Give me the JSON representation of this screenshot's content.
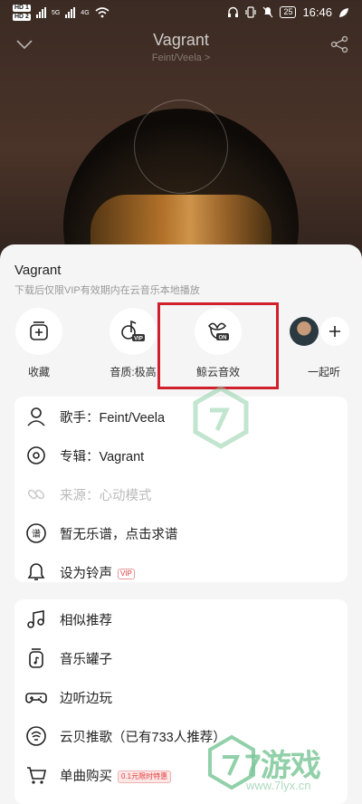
{
  "status_bar": {
    "hd1": "HD 1",
    "hd2": "HD 2",
    "net1": "5G",
    "net2": "4G",
    "battery": "25",
    "time": "16:46"
  },
  "player": {
    "title": "Vagrant",
    "artist": "Feint/Veela >"
  },
  "sheet": {
    "song_title": "Vagrant",
    "subtitle": "下载后仅限VIP有效期内在云音乐本地播放",
    "actions": [
      {
        "label": "收藏",
        "icon": "add-to-playlist-icon"
      },
      {
        "label": "音质:极高",
        "icon": "music-vip-icon"
      },
      {
        "label": "鲸云音效",
        "icon": "whale-sound-effect-on-icon"
      },
      {
        "label": "一起听",
        "icon": "listen-together-icon"
      }
    ],
    "info_rows": [
      {
        "label": "歌手：Feint/Veela",
        "icon": "person-icon"
      },
      {
        "label": "专辑：Vagrant",
        "icon": "disc-icon"
      },
      {
        "label": "来源：心动模式",
        "icon": "link-icon",
        "disabled": true
      },
      {
        "label": "暂无乐谱，点击求谱",
        "icon": "score-icon"
      },
      {
        "label": "设为铃声",
        "icon": "bell-icon",
        "badge": "VIP"
      }
    ],
    "more_rows": [
      {
        "label": "相似推荐",
        "icon": "music-notes-icon"
      },
      {
        "label": "音乐罐子",
        "icon": "music-jar-icon"
      },
      {
        "label": "边听边玩",
        "icon": "gamepad-icon"
      },
      {
        "label": "云贝推歌（已有733人推荐）",
        "icon": "yunbei-icon"
      },
      {
        "label": "单曲购买",
        "icon": "cart-icon",
        "badge": "0.1元限时特惠"
      }
    ]
  },
  "watermark": {
    "brand": "7游戏",
    "url": "www.7lyx.cn"
  },
  "colors": {
    "highlight_border": "#d0202c",
    "vip_red": "#e23a3a",
    "sheet_bg": "#f5f5f5"
  }
}
